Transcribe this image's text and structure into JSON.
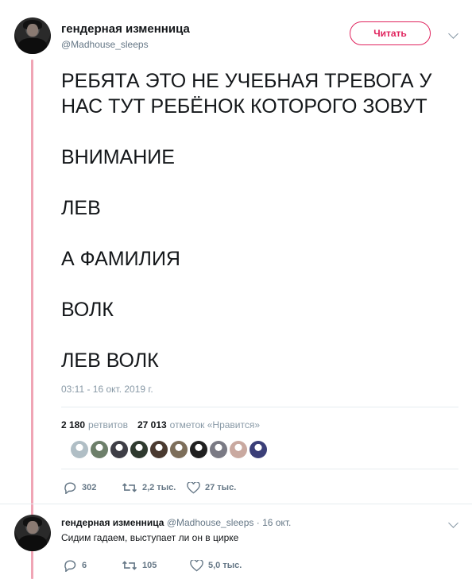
{
  "main_tweet": {
    "author_name": "гендерная изменница",
    "author_handle": "@Madhouse_sleeps",
    "follow_label": "Читать",
    "text_lines": [
      "РЕБЯТА ЭТО НЕ УЧЕБНАЯ ТРЕВОГА У",
      "НАС ТУТ РЕБЁНОК КОТОРОГО ЗОВУТ",
      "ВНИМАНИЕ",
      "ЛЕВ",
      "А ФАМИЛИЯ",
      "ВОЛК",
      "ЛЕВ ВОЛК"
    ],
    "timestamp": "03:11 - 16 окт. 2019 г.",
    "retweets_count": "2 180",
    "retweets_label": "ретвитов",
    "likes_count": "27 013",
    "likes_label": "отметок «Нравится»",
    "actions": {
      "reply_count": "302",
      "retweet_count": "2,2 тыс.",
      "like_count": "27 тыс."
    }
  },
  "likers": [
    "#b0bec5",
    "#6d7f6a",
    "#3e3e46",
    "#2f3a2f",
    "#4a3a30",
    "#7d6e5a",
    "#202020",
    "#7a7a84",
    "#c9a9a0",
    "#3b3f78"
  ],
  "reply_tweet": {
    "author_name": "гендерная изменница",
    "author_handle": "@Madhouse_sleeps",
    "time": "· 16 окт.",
    "text": "Сидим гадаем, выступает ли он в цирке",
    "actions": {
      "reply_count": "6",
      "retweet_count": "105",
      "like_count": "5,0 тыс."
    }
  }
}
